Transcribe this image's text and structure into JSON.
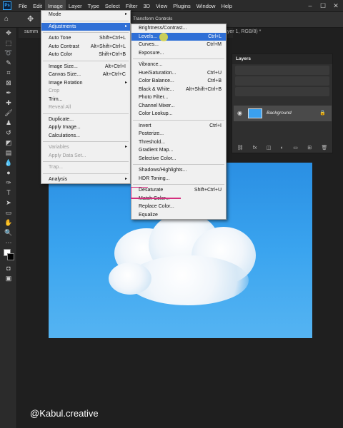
{
  "menubar": {
    "logo": "Ps",
    "items": [
      "File",
      "Edit",
      "Image",
      "Layer",
      "Type",
      "Select",
      "Filter",
      "3D",
      "View",
      "Plugins",
      "Window",
      "Help"
    ],
    "active_item": "Image"
  },
  "options_bar": {
    "transform_controls": "Transform Controls"
  },
  "document": {
    "tab_left": "summ",
    "tab_right": "ayer 1, RGB/8) *"
  },
  "image_menu": [
    {
      "label": "Mode",
      "arrow": "▸"
    },
    {
      "sep": true
    },
    {
      "label": "Adjustments",
      "arrow": "▸",
      "highlighted": true
    },
    {
      "sep": true
    },
    {
      "label": "Auto Tone",
      "shortcut": "Shift+Ctrl+L"
    },
    {
      "label": "Auto Contrast",
      "shortcut": "Alt+Shift+Ctrl+L"
    },
    {
      "label": "Auto Color",
      "shortcut": "Shift+Ctrl+B"
    },
    {
      "sep": true
    },
    {
      "label": "Image Size...",
      "shortcut": "Alt+Ctrl+I"
    },
    {
      "label": "Canvas Size...",
      "shortcut": "Alt+Ctrl+C"
    },
    {
      "label": "Image Rotation",
      "arrow": "▸"
    },
    {
      "label": "Crop",
      "disabled": true
    },
    {
      "label": "Trim..."
    },
    {
      "label": "Reveal All",
      "disabled": true
    },
    {
      "sep": true
    },
    {
      "label": "Duplicate..."
    },
    {
      "label": "Apply Image..."
    },
    {
      "label": "Calculations..."
    },
    {
      "sep": true
    },
    {
      "label": "Variables",
      "arrow": "▸",
      "disabled": true
    },
    {
      "label": "Apply Data Set...",
      "disabled": true
    },
    {
      "sep": true
    },
    {
      "label": "Trap...",
      "disabled": true
    },
    {
      "sep": true
    },
    {
      "label": "Analysis",
      "arrow": "▸"
    }
  ],
  "adjustments_menu": [
    {
      "label": "Brightness/Contrast..."
    },
    {
      "label": "Levels...",
      "shortcut": "Ctrl+L",
      "highlighted": true
    },
    {
      "label": "Curves...",
      "shortcut": "Ctrl+M"
    },
    {
      "label": "Exposure..."
    },
    {
      "sep": true
    },
    {
      "label": "Vibrance..."
    },
    {
      "label": "Hue/Saturation...",
      "shortcut": "Ctrl+U"
    },
    {
      "label": "Color Balance...",
      "shortcut": "Ctrl+B"
    },
    {
      "label": "Black & White...",
      "shortcut": "Alt+Shift+Ctrl+B"
    },
    {
      "label": "Photo Filter..."
    },
    {
      "label": "Channel Mixer..."
    },
    {
      "label": "Color Lookup..."
    },
    {
      "sep": true
    },
    {
      "label": "Invert",
      "shortcut": "Ctrl+I"
    },
    {
      "label": "Posterize..."
    },
    {
      "label": "Threshold..."
    },
    {
      "label": "Gradient Map..."
    },
    {
      "label": "Selective Color..."
    },
    {
      "sep": true
    },
    {
      "label": "Shadows/Highlights..."
    },
    {
      "label": "HDR Toning..."
    },
    {
      "sep": true
    },
    {
      "label": "Desaturate",
      "shortcut": "Shift+Ctrl+U",
      "marked": true
    },
    {
      "label": "Match Color..."
    },
    {
      "label": "Replace Color..."
    },
    {
      "label": "Equalize"
    }
  ],
  "layers_panel": {
    "title": "Layers",
    "layer_name": "Background"
  },
  "watermark": "@Kabul.creative",
  "colors": {
    "menu_highlight": "#2f6fd6",
    "annotation": "#d42f7e",
    "sky": "#3aa4ef"
  }
}
